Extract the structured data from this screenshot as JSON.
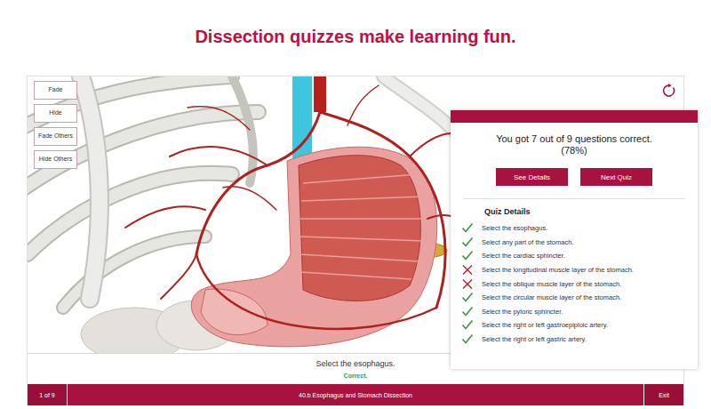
{
  "headline": "Dissection quizzes make learning fun.",
  "tools": [
    "Fade",
    "Hide",
    "Fade Others",
    "Hide Others"
  ],
  "result": {
    "summary": "You got 7 out of 9 questions correct.",
    "percent": "(78%)"
  },
  "buttons": [
    "See Details",
    "Next Quiz"
  ],
  "details": {
    "title": "Quiz Details",
    "items": [
      {
        "text": "Select the esophagus.",
        "correct": true
      },
      {
        "text": "Select any part of the stomach.",
        "correct": true
      },
      {
        "text": "Select the cardiac sphincter.",
        "correct": true
      },
      {
        "text": "Select the longitudinal muscle layer of the stomach.",
        "correct": false
      },
      {
        "text": "Select the oblique muscle layer of the stomach.",
        "correct": false
      },
      {
        "text": "Select the circular muscle layer of the stomach.",
        "correct": true
      },
      {
        "text": "Select the pyloric sphincter.",
        "correct": true
      },
      {
        "text": "Select the right or left gastroepiploic artery.",
        "correct": true
      },
      {
        "text": "Select the right or left gastric artery.",
        "correct": true
      }
    ]
  },
  "prompt": {
    "question": "Select the esophagus.",
    "feedback": "Correct."
  },
  "footer": {
    "counter": "1 of 9",
    "title": "40.b Esophagus and Stomach Dissection",
    "exit": "Exit"
  }
}
